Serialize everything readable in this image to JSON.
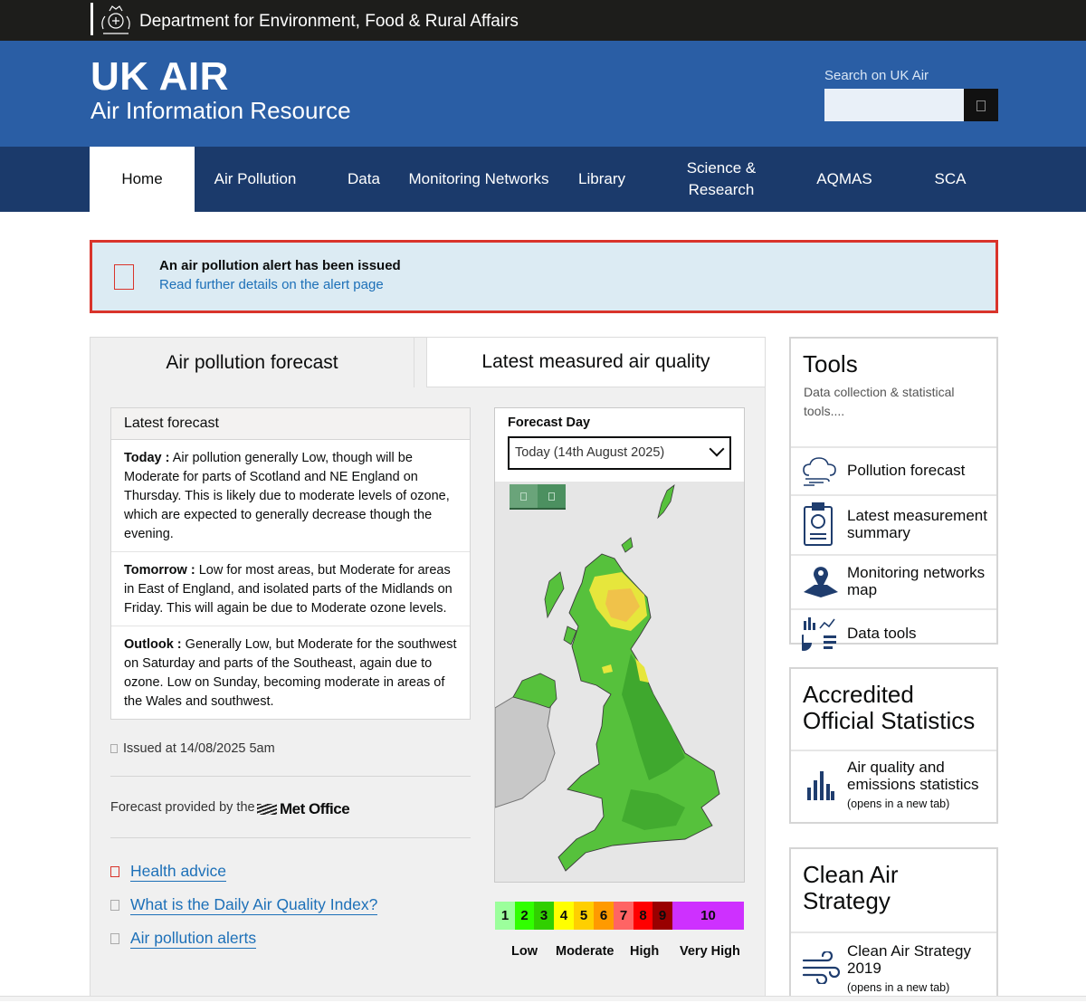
{
  "topbar": {
    "department": "Department for Environment, Food & Rural Affairs"
  },
  "header": {
    "title": "UK AIR",
    "subtitle": "Air Information Resource",
    "search_label": "Search on UK Air",
    "search_value": ""
  },
  "nav": {
    "items": [
      {
        "label": "Home"
      },
      {
        "label": "Air Pollution"
      },
      {
        "label": "Data"
      },
      {
        "label": "Monitoring Networks"
      },
      {
        "label": "Library"
      },
      {
        "label": "Science & Research"
      },
      {
        "label": "AQMAS"
      },
      {
        "label": "SCA"
      }
    ]
  },
  "alert": {
    "title": "An air pollution alert has been issued",
    "link": "Read further details on the alert page"
  },
  "tabs": [
    {
      "label": "Air pollution forecast",
      "active": true
    },
    {
      "label": "Latest measured air quality",
      "active": false
    }
  ],
  "forecast": {
    "heading": "Latest forecast",
    "items": [
      {
        "day": "Today :",
        "text": " Air pollution generally Low, though will be Moderate for parts of Scotland and NE England on Thursday. This is likely due to moderate levels of ozone, which are expected to generally decrease though the evening."
      },
      {
        "day": "Tomorrow :",
        "text": " Low for most areas, but Moderate for areas in East of England, and isolated parts of the Midlands on Friday. This will again be due to Moderate ozone levels."
      },
      {
        "day": "Outlook :",
        "text": " Generally Low, but Moderate for the southwest on Saturday and parts of the Southeast, again due to ozone. Low on Sunday, becoming moderate in areas of the Wales and southwest."
      }
    ],
    "issued": "Issued at 14/08/2025 5am",
    "provided_by": "Forecast provided by the",
    "provider": "Met Office"
  },
  "links": [
    {
      "label": "Health advice",
      "icon": "health-icon",
      "color": "#d9342b"
    },
    {
      "label": "What is the Daily Air Quality Index?",
      "icon": "info-icon",
      "color": "#aaaaaa"
    },
    {
      "label": "Air pollution alerts",
      "icon": "alert-icon",
      "color": "#aaaaaa"
    }
  ],
  "map": {
    "forecast_day_label": "Forecast Day",
    "selected_day": "Today (14th August 2025)"
  },
  "index_scale": {
    "bands": [
      {
        "value": "1",
        "color": "#9cff9c"
      },
      {
        "value": "2",
        "color": "#31ff00"
      },
      {
        "value": "3",
        "color": "#31cf00"
      },
      {
        "value": "4",
        "color": "#ffff00"
      },
      {
        "value": "5",
        "color": "#ffcf00"
      },
      {
        "value": "6",
        "color": "#ff9a00"
      },
      {
        "value": "7",
        "color": "#ff6464"
      },
      {
        "value": "8",
        "color": "#ff0000"
      },
      {
        "value": "9",
        "color": "#990000"
      },
      {
        "value": "10",
        "color": "#ce30ff"
      }
    ],
    "labels": [
      "Low",
      "Moderate",
      "High",
      "Very High"
    ]
  },
  "tools": {
    "title": "Tools",
    "description": "Data collection & statistical tools....",
    "items": [
      {
        "label": "Pollution forecast",
        "icon": "cloud-wind-icon"
      },
      {
        "label": "Latest measurement summary",
        "icon": "clipboard-icon"
      },
      {
        "label": "Monitoring networks map",
        "icon": "map-pin-icon"
      },
      {
        "label": "Data tools",
        "icon": "charts-icon"
      }
    ]
  },
  "accredited": {
    "title": "Accredited Official Statistics",
    "item": {
      "label": "Air quality and emissions statistics",
      "sub": "(opens in a new tab)",
      "icon": "bar-chart-icon"
    }
  },
  "clean_air": {
    "title": "Clean Air Strategy",
    "item": {
      "label": "Clean Air Strategy 2019",
      "sub": "(opens in a new tab)",
      "icon": "wind-icon"
    }
  },
  "colors": {
    "header_blue": "#2a5ea5",
    "nav_blue": "#1b3a6b",
    "alert_red": "#d9342b",
    "link_blue": "#1d70b8",
    "icon_navy": "#1f3d6e"
  }
}
